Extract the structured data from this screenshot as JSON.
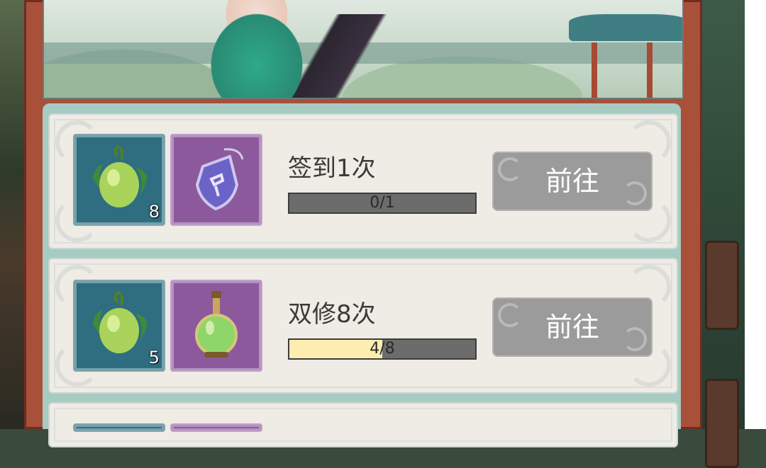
{
  "tasks": [
    {
      "title": "签到1次",
      "progress_text": "0/1",
      "progress_fraction": 0,
      "button_label": "前往",
      "rewards": [
        {
          "icon": "green-fruit-icon",
          "count": "8",
          "frame": "teal"
        },
        {
          "icon": "purple-token-icon",
          "count": "",
          "frame": "purple"
        }
      ]
    },
    {
      "title": "双修8次",
      "progress_text": "4/8",
      "progress_fraction": 0.5,
      "button_label": "前往",
      "rewards": [
        {
          "icon": "green-fruit-icon",
          "count": "5",
          "frame": "teal"
        },
        {
          "icon": "green-potion-icon",
          "count": "",
          "frame": "purple"
        }
      ]
    }
  ],
  "colors": {
    "panel_frame": "#a8503a",
    "list_bg": "#a7cbc3",
    "card_bg": "#efebe5",
    "progress_fill": "#fdeeb0",
    "progress_track": "#6c6c6c",
    "button_disabled": "#9b9b9b"
  }
}
